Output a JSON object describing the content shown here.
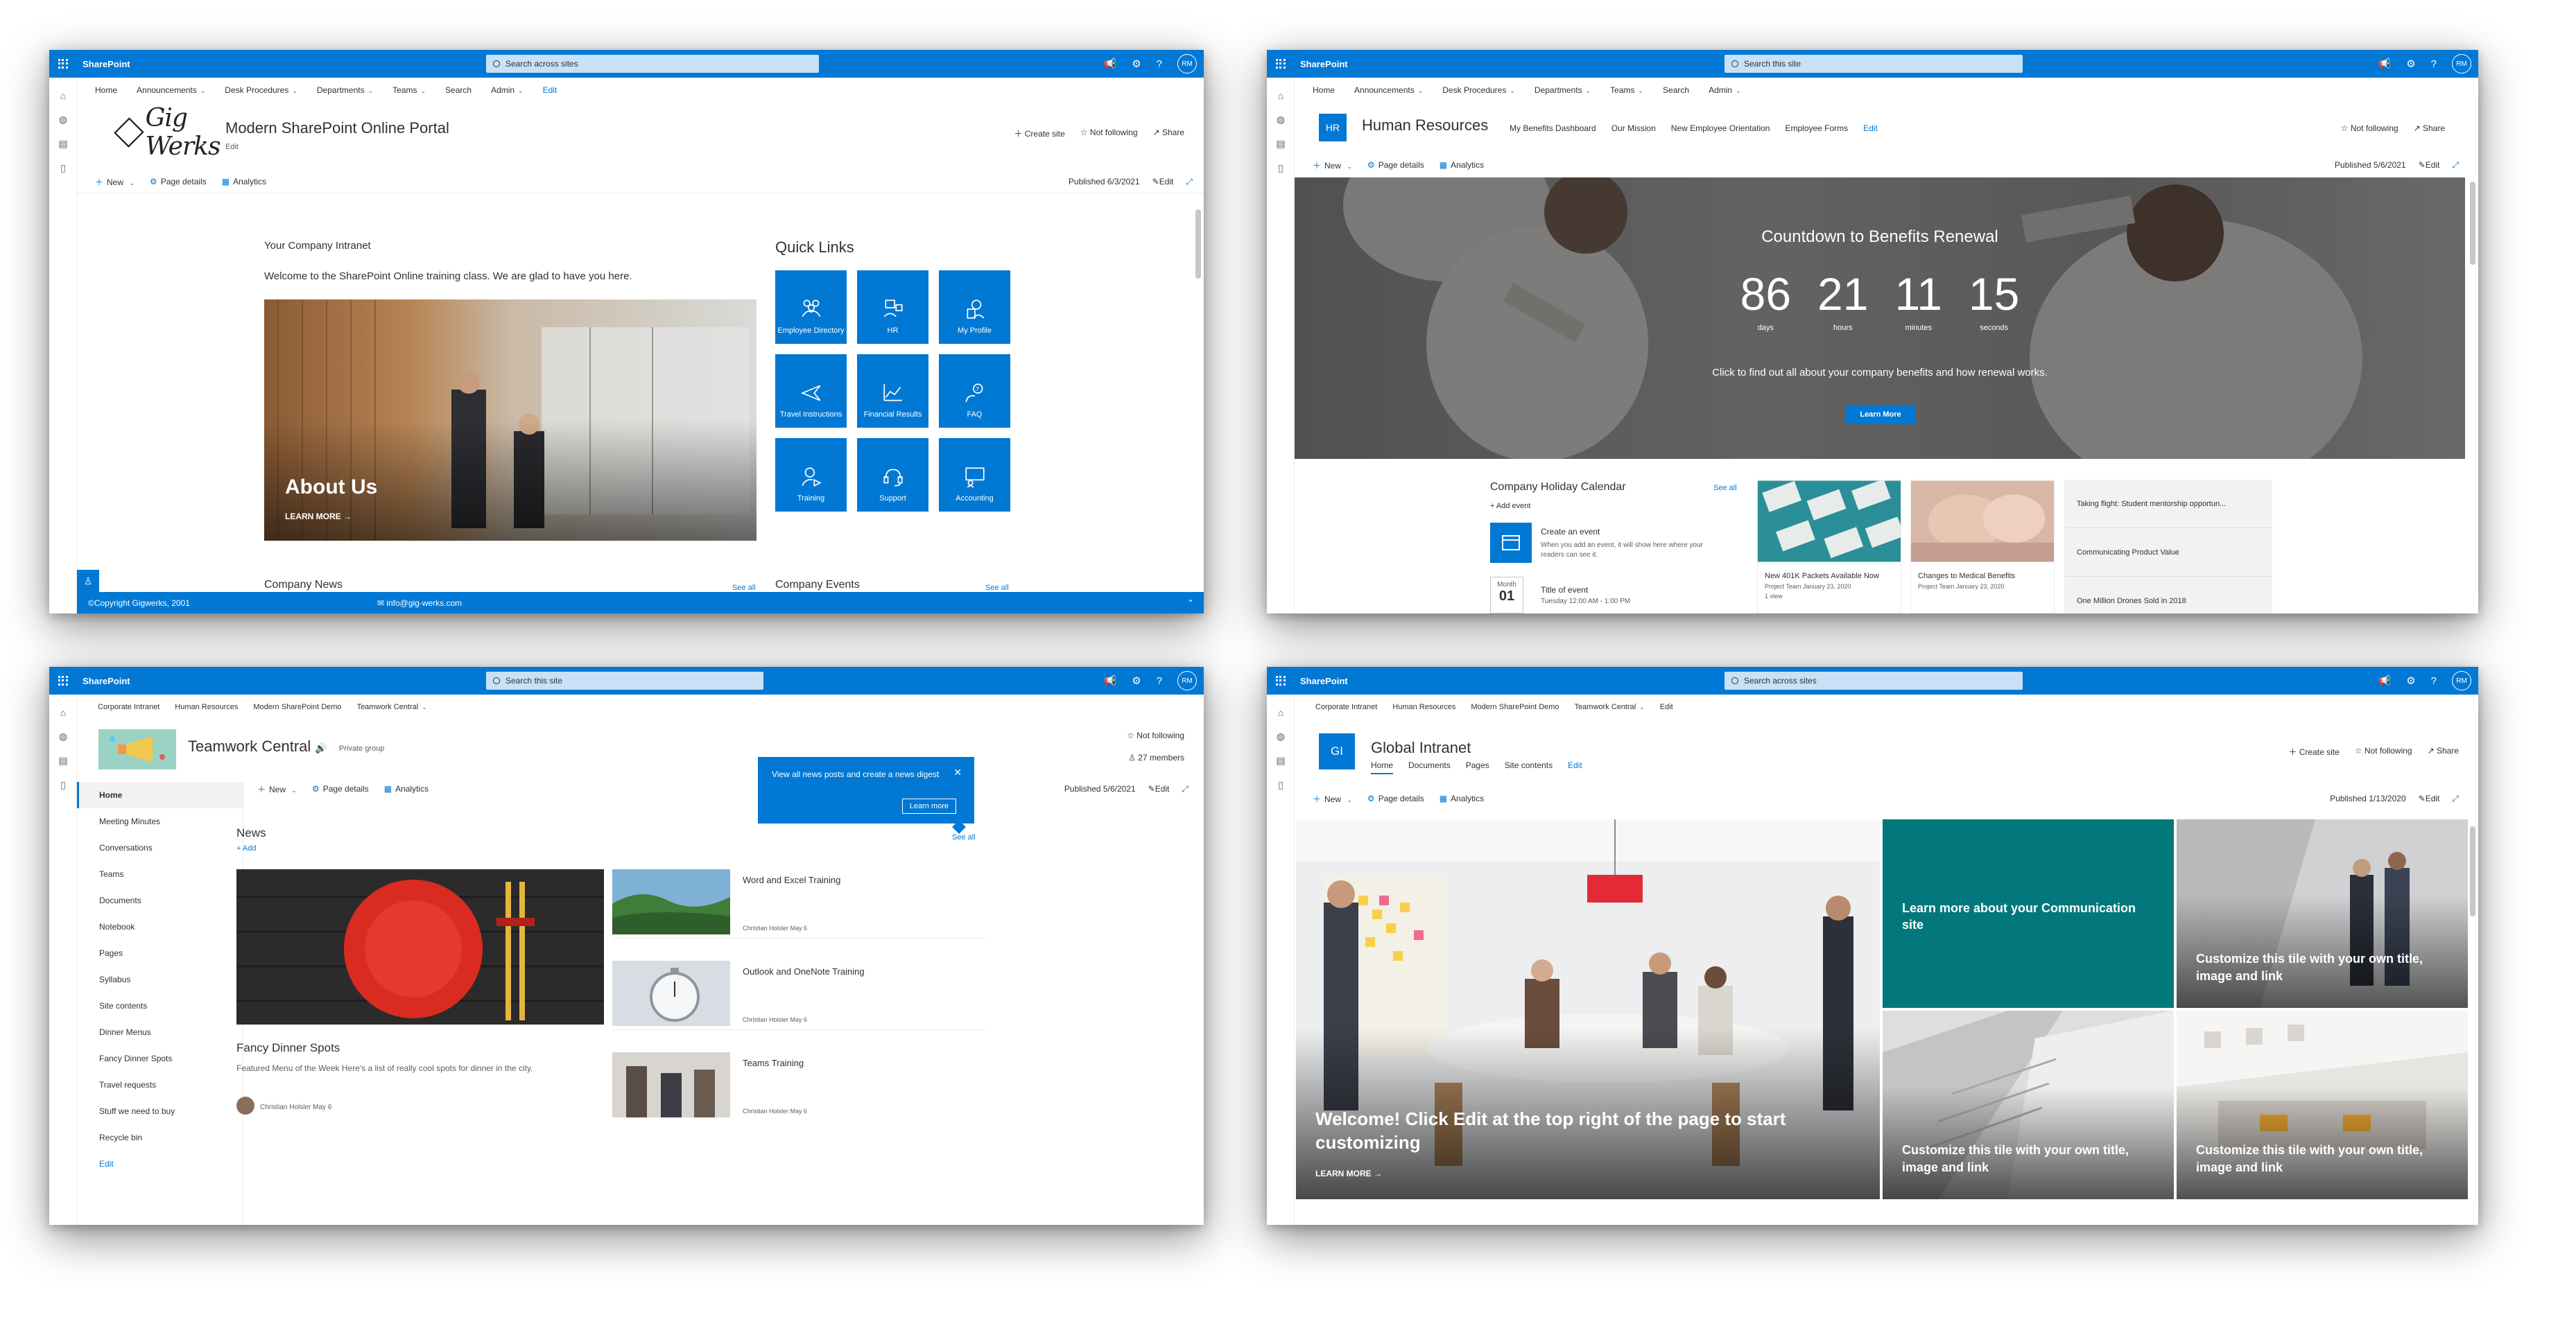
{
  "panel1": {
    "suite": {
      "app": "SharePoint",
      "search_placeholder": "Search across sites",
      "avatar": "RM"
    },
    "nav": [
      {
        "label": "Home",
        "dropdown": false
      },
      {
        "label": "Announcements",
        "dropdown": true
      },
      {
        "label": "Desk Procedures",
        "dropdown": true
      },
      {
        "label": "Departments",
        "dropdown": true
      },
      {
        "label": "Teams",
        "dropdown": true
      },
      {
        "label": "Search",
        "dropdown": false
      },
      {
        "label": "Admin",
        "dropdown": true
      }
    ],
    "nav_edit": "Edit",
    "logo_text": "Gig Werks",
    "site_title": "Modern SharePoint Online Portal",
    "site_edit": "Edit",
    "actions": {
      "create": "Create site",
      "follow": "Not following",
      "share": "Share"
    },
    "cmd": {
      "new": "New",
      "details": "Page details",
      "analytics": "Analytics",
      "published": "Published 6/3/2021",
      "edit": "Edit"
    },
    "intro_label": "Your Company Intranet",
    "intro_text": "Welcome to the SharePoint Online training class. We are glad to have you here.",
    "about_title": "About Us",
    "about_link": "LEARN MORE →",
    "quick_links_title": "Quick Links",
    "quick_links": [
      {
        "label": "Employee Directory",
        "icon": "people-icon"
      },
      {
        "label": "HR",
        "icon": "org-icon"
      },
      {
        "label": "My Profile",
        "icon": "profile-icon"
      },
      {
        "label": "Travel Instructions",
        "icon": "airplane-icon"
      },
      {
        "label": "Financial Results",
        "icon": "chart-icon"
      },
      {
        "label": "FAQ",
        "icon": "faq-icon"
      },
      {
        "label": "Training",
        "icon": "training-icon"
      },
      {
        "label": "Support",
        "icon": "headset-icon"
      },
      {
        "label": "Accounting",
        "icon": "accounting-icon"
      }
    ],
    "section_news": "Company News",
    "section_events": "Company Events",
    "see_all": "See all",
    "footer_copy": "©Copyright Gigwerks, 2001",
    "footer_email": "info@gig-werks.com"
  },
  "panel2": {
    "suite": {
      "app": "SharePoint",
      "search_placeholder": "Search this site",
      "avatar": "RM"
    },
    "nav": [
      {
        "label": "Home",
        "dropdown": false
      },
      {
        "label": "Announcements",
        "dropdown": true
      },
      {
        "label": "Desk Procedures",
        "dropdown": true
      },
      {
        "label": "Departments",
        "dropdown": true
      },
      {
        "label": "Teams",
        "dropdown": true
      },
      {
        "label": "Search",
        "dropdown": false
      },
      {
        "label": "Admin",
        "dropdown": true
      }
    ],
    "badge": "HR",
    "site_title": "Human Resources",
    "site_nav": [
      "My Benefits Dashboard",
      "Our Mission",
      "New Employee Orientation",
      "Employee Forms"
    ],
    "site_nav_edit": "Edit",
    "actions": {
      "follow": "Not following",
      "share": "Share"
    },
    "cmd": {
      "new": "New",
      "details": "Page details",
      "analytics": "Analytics",
      "published": "Published 5/6/2021",
      "edit": "Edit"
    },
    "hero_title": "Countdown to Benefits Renewal",
    "countdown": [
      {
        "value": "86",
        "label": "days"
      },
      {
        "value": "21",
        "label": "hours"
      },
      {
        "value": "11",
        "label": "minutes"
      },
      {
        "value": "15",
        "label": "seconds"
      }
    ],
    "hero_desc": "Click to find out all about your company benefits and how renewal works.",
    "hero_button": "Learn More",
    "calendar": {
      "title": "Company Holiday Calendar",
      "see_all": "See all",
      "add": "+ Add event",
      "create_title": "Create an event",
      "create_desc": "When you add an event, it will show here where your readers can see it.",
      "month": "Month",
      "day": "01",
      "event_title": "Title of event",
      "event_time": "Tuesday 12:00 AM - 1:00 PM"
    },
    "news": [
      {
        "title": "New 401K Packets Available Now",
        "meta": "Project Team  January 23, 2020",
        "extra": "1 view"
      },
      {
        "title": "Changes to Medical Benefits",
        "meta": "Project Team  January 23, 2020"
      }
    ],
    "news_list": [
      "Taking flight: Student mentorship opportun...",
      "Communicating Product Value",
      "One Million Drones Sold in 2018"
    ]
  },
  "panel3": {
    "suite": {
      "app": "SharePoint",
      "search_placeholder": "Search this site",
      "avatar": "RM"
    },
    "breadcrumb": [
      "Corporate Intranet",
      "Human Resources",
      "Modern SharePoint Demo",
      "Teamwork Central"
    ],
    "site_title": "Teamwork Central",
    "privacy": "Private group",
    "follow": "Not following",
    "members": "27 members",
    "leftnav": [
      "Home",
      "Meeting Minutes",
      "Conversations",
      "Teams",
      "Documents",
      "Notebook",
      "Pages",
      "Syllabus",
      "Site contents",
      "Dinner Menus",
      "Fancy Dinner Spots",
      "Travel requests",
      "Stuff we need to buy",
      "Recycle bin"
    ],
    "leftnav_edit": "Edit",
    "cmd": {
      "new": "New",
      "details": "Page details",
      "analytics": "Analytics",
      "published": "Published 5/6/2021",
      "edit": "Edit"
    },
    "teaching": {
      "text": "View all news posts and create a news digest",
      "button": "Learn more"
    },
    "news_title": "News",
    "news_add": "+ Add",
    "news_see_all": "See all",
    "featured": {
      "title": "Fancy Dinner Spots",
      "desc": "Featured Menu of the Week Here's a list of really cool spots for dinner in the city.",
      "author": "Christian Holsler  May 6"
    },
    "side_news": [
      {
        "title": "Word and Excel Training",
        "author": "Christian Holsler  May 6"
      },
      {
        "title": "Outlook and OneNote Training",
        "author": "Christian Holsler  May 6"
      },
      {
        "title": "Teams Training",
        "author": "Christian Holsler  May 6"
      }
    ]
  },
  "panel4": {
    "suite": {
      "app": "SharePoint",
      "search_placeholder": "Search across sites",
      "avatar": "RM"
    },
    "hubnav": [
      "Corporate Intranet",
      "Human Resources",
      "Modern SharePoint Demo",
      "Teamwork Central"
    ],
    "hubnav_edit": "Edit",
    "badge": "GI",
    "site_title": "Global Intranet",
    "site_nav": [
      "Home",
      "Documents",
      "Pages",
      "Site contents"
    ],
    "site_nav_edit": "Edit",
    "actions": {
      "create": "Create site",
      "follow": "Not following",
      "share": "Share"
    },
    "cmd": {
      "new": "New",
      "details": "Page details",
      "analytics": "Analytics",
      "published": "Published 1/13/2020",
      "edit": "Edit"
    },
    "hero_text": "Welcome! Click Edit at the top right of the page to start customizing",
    "hero_link": "LEARN MORE →",
    "tile_teal": "Learn more about your Communication site",
    "tile_custom": "Customize this tile with your own title, image and link",
    "accent_teal": "#03787c"
  }
}
